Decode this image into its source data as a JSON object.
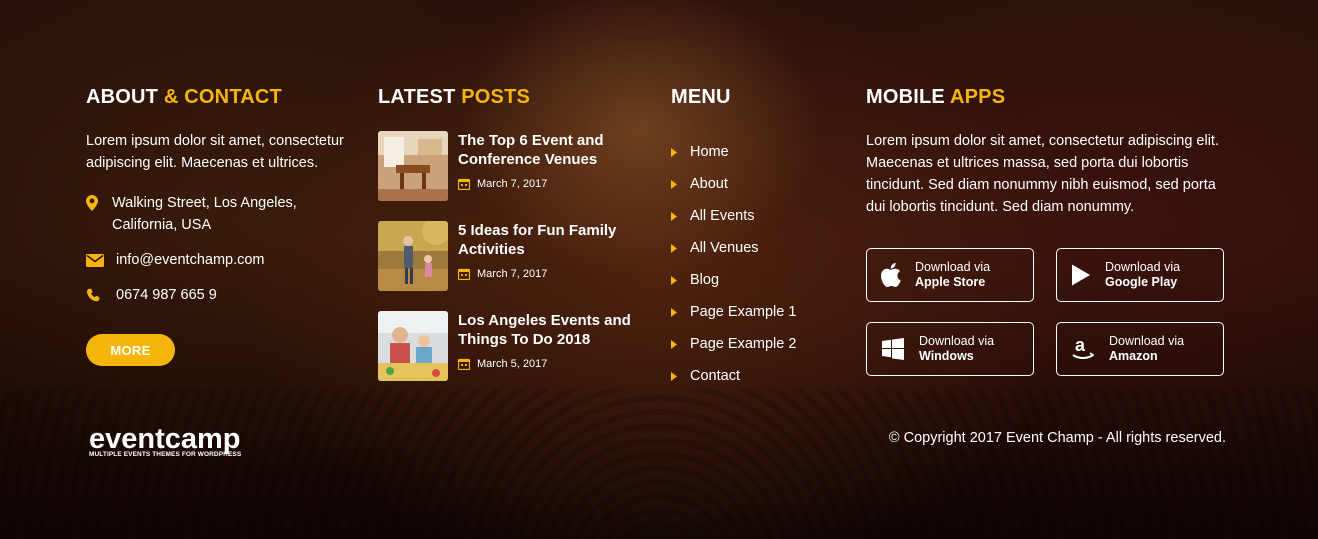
{
  "colors": {
    "accent": "#f5b50a",
    "text": "#ffffff"
  },
  "about": {
    "title_main": "ABOUT",
    "title_accent": "& CONTACT",
    "text": "Lorem ipsum dolor sit amet, consectetur adipiscing elit. Maecenas et ultrices.",
    "address_line1": "Walking Street, Los Angeles,",
    "address_line2": "California, USA",
    "email": "info@eventchamp.com",
    "phone": "0674 987 665 9",
    "more_label": "MORE",
    "icons": [
      "map-marker-icon",
      "envelope-icon",
      "phone-icon"
    ]
  },
  "posts": {
    "title_main": "LATEST",
    "title_accent": "POSTS",
    "items": [
      {
        "title": "The Top 6 Event and Conference Venues",
        "date": "March 7, 2017"
      },
      {
        "title": "5 Ideas for Fun Family Activities",
        "date": "March 7, 2017"
      },
      {
        "title": "Los Angeles Events and Things To Do 2018",
        "date": "March 5, 2017"
      }
    ]
  },
  "menu": {
    "title": "MENU",
    "items": [
      "Home",
      "About",
      "All Events",
      "All Venues",
      "Blog",
      "Page Example 1",
      "Page Example 2",
      "Contact"
    ]
  },
  "apps": {
    "title_main": "MOBILE",
    "title_accent": "APPS",
    "text": "Lorem ipsum dolor sit amet, consectetur adipiscing elit. Maecenas et ultrices massa, sed porta dui lobortis tincidunt. Sed diam nonummy nibh euismod, sed porta dui lobortis tincidunt. Sed diam nonummy.",
    "buttons": [
      {
        "small": "Download via",
        "store": "Apple Store",
        "icon": "apple-icon"
      },
      {
        "small": "Download via",
        "store": "Google Play",
        "icon": "google-play-icon"
      },
      {
        "small": "Download via",
        "store": "Windows",
        "icon": "windows-icon"
      },
      {
        "small": "Download via",
        "store": "Amazon",
        "icon": "amazon-icon"
      }
    ]
  },
  "footer": {
    "logo_word": "eventcamp",
    "logo_tagline": "MULTIPLE EVENTS THEMES FOR WORDPRESS",
    "copyright": "© Copyright 2017 Event Champ - All rights reserved."
  }
}
